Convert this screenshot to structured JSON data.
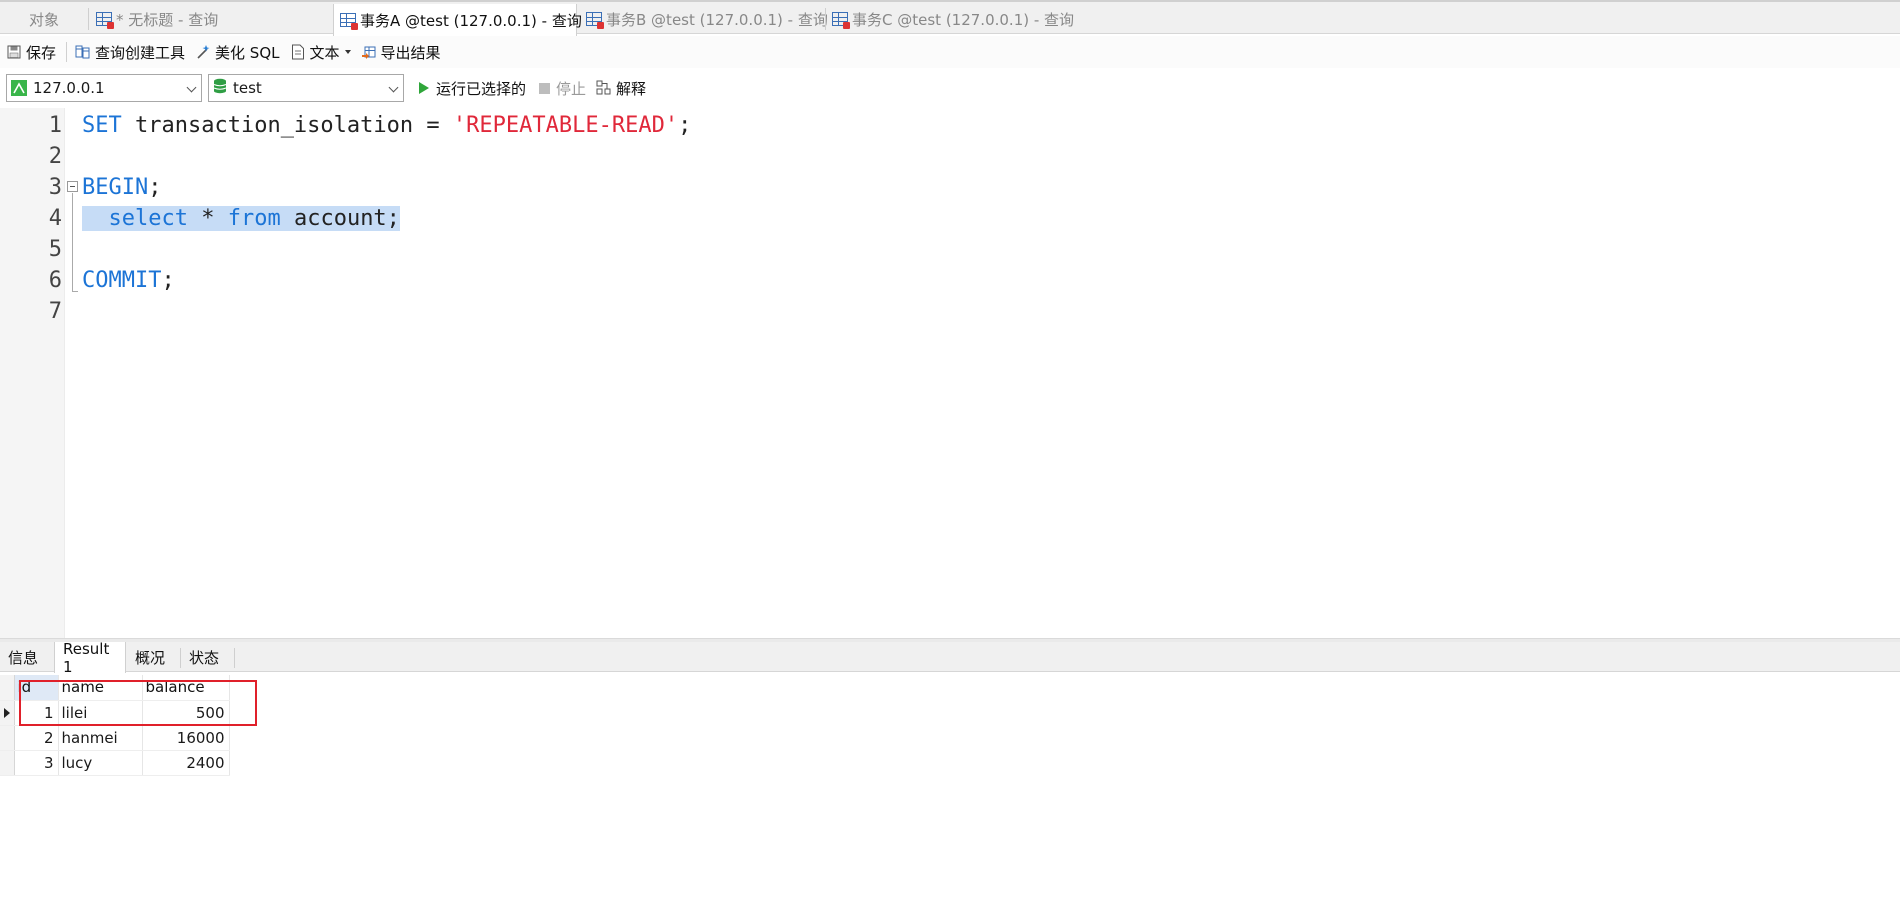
{
  "tabs": [
    {
      "label": "对象"
    },
    {
      "label": "* 无标题 - 查询"
    },
    {
      "label": "事务A @test (127.0.0.1) - 查询"
    },
    {
      "label": "事务B @test (127.0.0.1) - 查询"
    },
    {
      "label": "事务C @test (127.0.0.1) - 查询"
    }
  ],
  "toolbar": {
    "save": "保存",
    "query_builder": "查询创建工具",
    "beautify": "美化 SQL",
    "text": "文本",
    "export": "导出结果"
  },
  "toolbar2": {
    "connection": "127.0.0.1",
    "database": "test",
    "run_selected": "运行已选择的",
    "stop": "停止",
    "explain": "解释"
  },
  "editor": {
    "line_numbers": [
      "1",
      "2",
      "3",
      "4",
      "5",
      "6",
      "7"
    ],
    "line1_kw": "SET",
    "line1_mid": " transaction_isolation = ",
    "line1_str": "'REPEATABLE-READ'",
    "line1_end": ";",
    "line3_kw": "BEGIN",
    "line3_end": ";",
    "line4_indent": "  ",
    "line4_kw1": "select",
    "line4_mid": " * ",
    "line4_kw2": "from",
    "line4_end": " account;",
    "line6_kw": "COMMIT",
    "line6_end": ";"
  },
  "result_tabs": [
    {
      "label": "信息"
    },
    {
      "label": "Result 1"
    },
    {
      "label": "概况"
    },
    {
      "label": "状态"
    }
  ],
  "grid": {
    "columns": [
      "id",
      "name",
      "balance"
    ],
    "rows": [
      {
        "id": "1",
        "name": "lilei",
        "balance": "500"
      },
      {
        "id": "2",
        "name": "hanmei",
        "balance": "16000"
      },
      {
        "id": "3",
        "name": "lucy",
        "balance": "2400"
      }
    ]
  },
  "colors": {
    "keyword": "#1c74d6",
    "string": "#e0283a",
    "selection": "#c6dcf6",
    "highlight_box": "#e0202a"
  }
}
